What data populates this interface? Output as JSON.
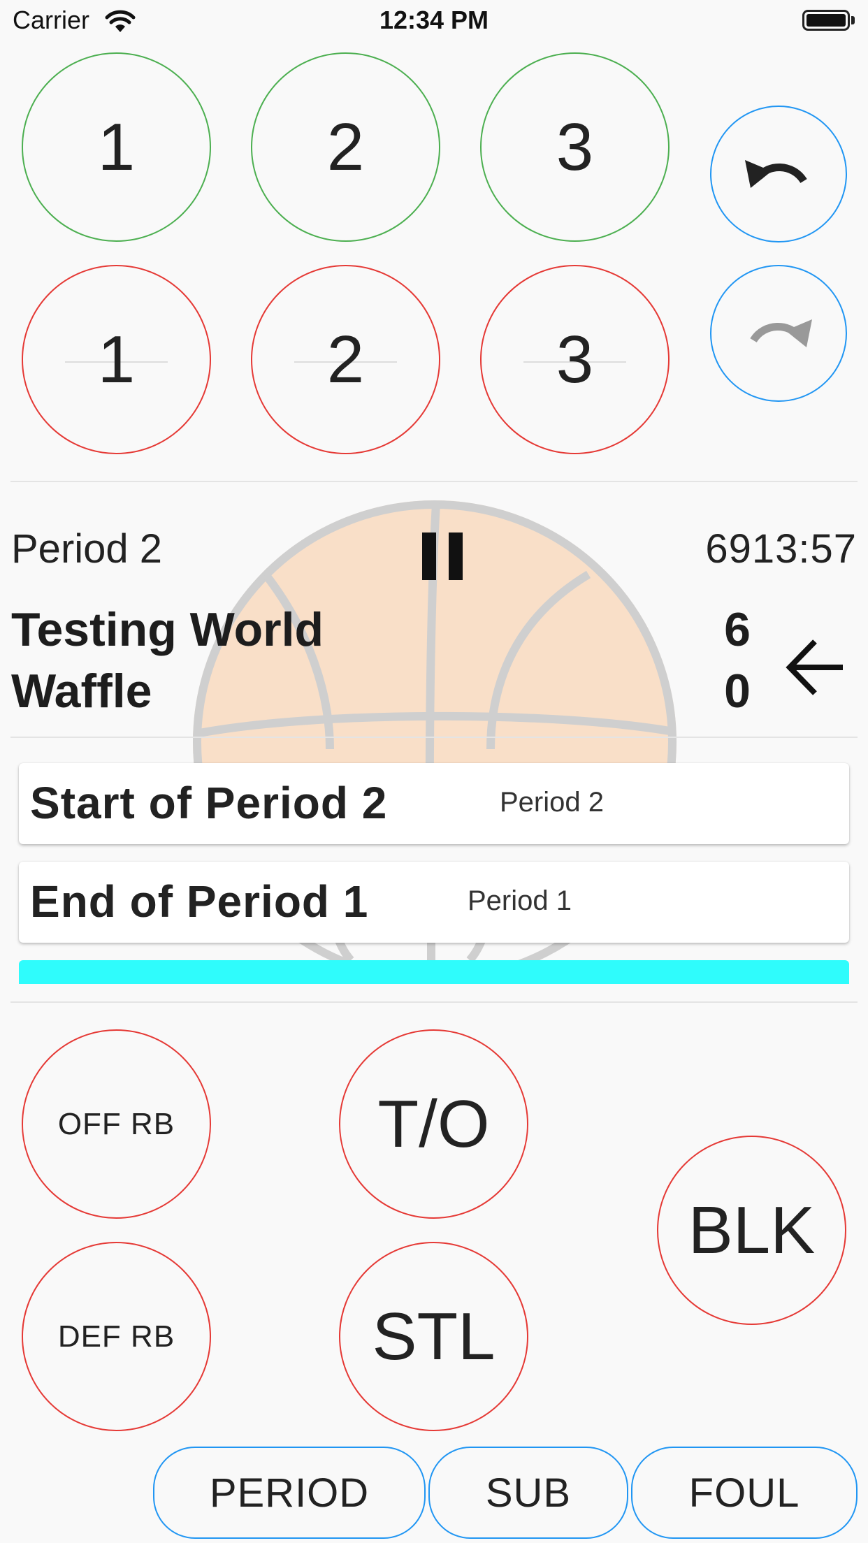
{
  "status_bar": {
    "carrier": "Carrier",
    "time": "12:34 PM"
  },
  "scoring": {
    "made_shots": [
      "1",
      "2",
      "3"
    ],
    "missed_shots": [
      "1",
      "2",
      "3"
    ]
  },
  "history": {
    "undo_icon": "undo-icon",
    "redo_icon": "redo-icon"
  },
  "game": {
    "period": "Period 2",
    "pause_icon": "pause-icon",
    "clock": "6913:57",
    "home_team": "Testing World",
    "away_team": "Waffle",
    "home_score": "6",
    "away_score": "0",
    "possession_icon": "arrow-left-icon",
    "background_icon": "basketball-icon"
  },
  "play_log": [
    {
      "title": "Start of Period 2",
      "period": "Period 2"
    },
    {
      "title": "End of Period 1",
      "period": "Period 1"
    }
  ],
  "actions": {
    "off_rb": "OFF RB",
    "def_rb": "DEF RB",
    "turnover": "T/O",
    "steal": "STL",
    "block": "BLK"
  },
  "bottom_bar": {
    "period": "PERIOD",
    "sub": "SUB",
    "foul": "FOUL"
  },
  "colors": {
    "made": "#4caf50",
    "missed": "#e53935",
    "control": "#2196f3",
    "highlight": "#2ffcfc",
    "basketball": "#f9dfc8"
  }
}
